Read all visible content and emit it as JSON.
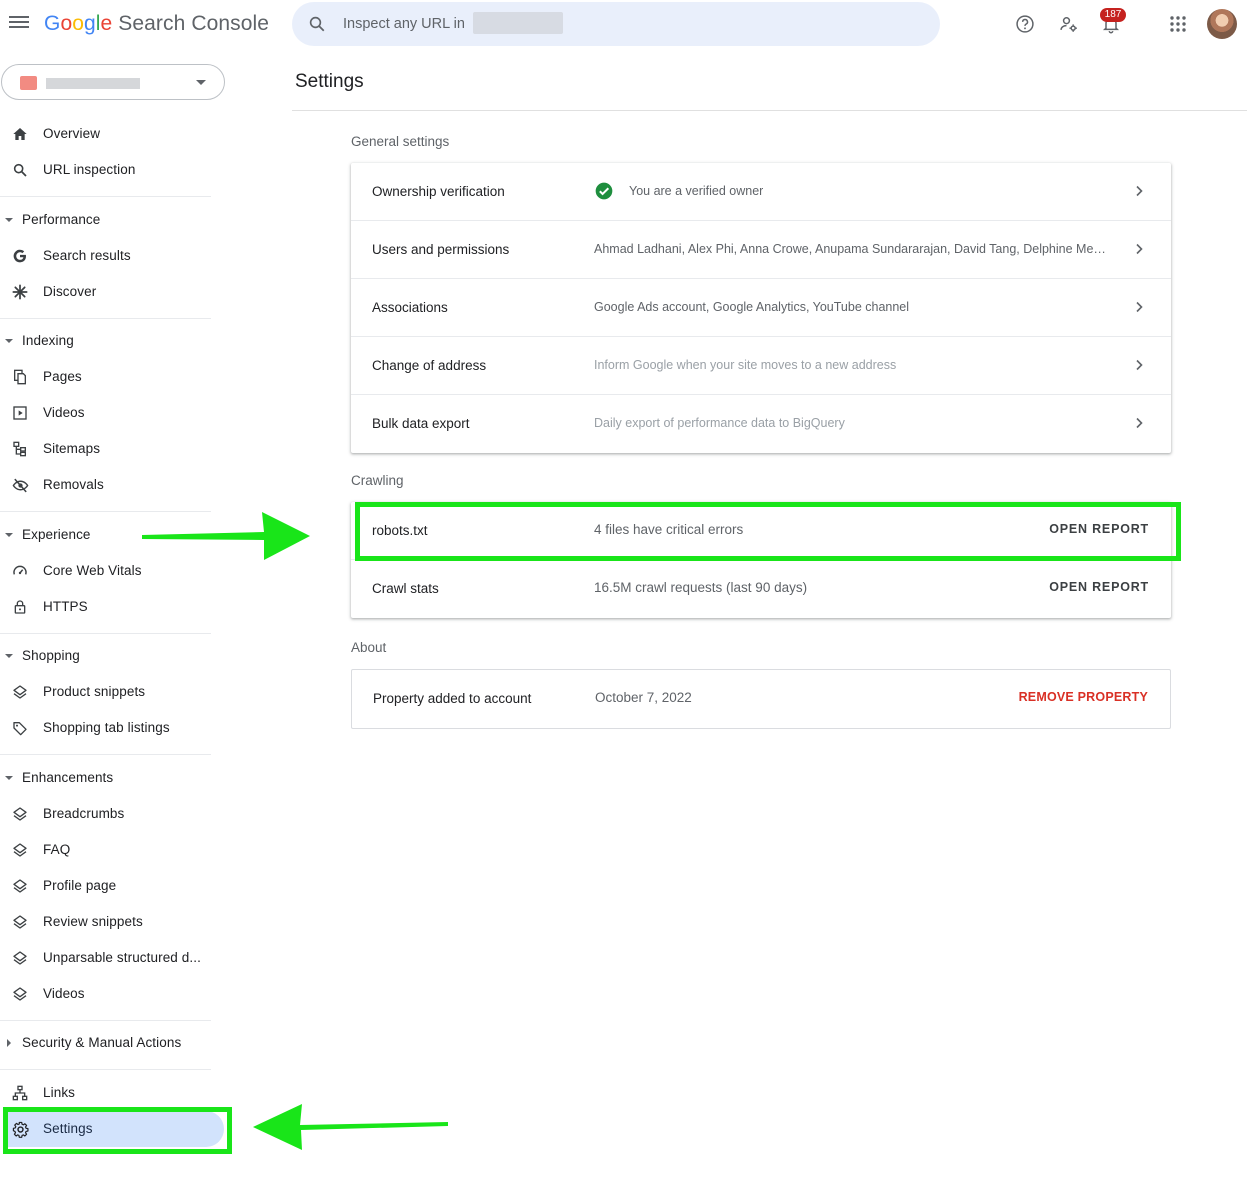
{
  "header": {
    "logo_brand": "Google",
    "logo_product": "Search Console",
    "search_placeholder": "Inspect any URL in",
    "notification_count": "187"
  },
  "sidebar": {
    "top_items": [
      {
        "label": "Overview",
        "icon": "home-icon"
      },
      {
        "label": "URL inspection",
        "icon": "search-icon"
      }
    ],
    "sections": [
      {
        "label": "Performance",
        "items": [
          {
            "label": "Search results",
            "icon": "google-g-icon"
          },
          {
            "label": "Discover",
            "icon": "asterisk-icon"
          }
        ]
      },
      {
        "label": "Indexing",
        "items": [
          {
            "label": "Pages",
            "icon": "pages-icon"
          },
          {
            "label": "Videos",
            "icon": "video-icon"
          },
          {
            "label": "Sitemaps",
            "icon": "sitemap-icon"
          },
          {
            "label": "Removals",
            "icon": "eye-off-icon"
          }
        ]
      },
      {
        "label": "Experience",
        "items": [
          {
            "label": "Core Web Vitals",
            "icon": "gauge-icon"
          },
          {
            "label": "HTTPS",
            "icon": "lock-icon"
          }
        ]
      },
      {
        "label": "Shopping",
        "items": [
          {
            "label": "Product snippets",
            "icon": "layers-icon"
          },
          {
            "label": "Shopping tab listings",
            "icon": "tag-icon"
          }
        ]
      },
      {
        "label": "Enhancements",
        "items": [
          {
            "label": "Breadcrumbs",
            "icon": "layers-icon"
          },
          {
            "label": "FAQ",
            "icon": "layers-icon"
          },
          {
            "label": "Profile page",
            "icon": "layers-icon"
          },
          {
            "label": "Review snippets",
            "icon": "layers-icon"
          },
          {
            "label": "Unparsable structured d...",
            "icon": "layers-icon"
          },
          {
            "label": "Videos",
            "icon": "layers-icon"
          }
        ]
      }
    ],
    "security_section": "Security & Manual Actions",
    "links_label": "Links",
    "settings_label": "Settings"
  },
  "main": {
    "title": "Settings",
    "general": {
      "label": "General settings",
      "rows": [
        {
          "title": "Ownership verification",
          "value": "You are a verified owner"
        },
        {
          "title": "Users and permissions",
          "value": "Ahmad Ladhani, Alex Phi, Anna Crowe, Anupama Sundararajan, David Tang, Delphine Merv..."
        },
        {
          "title": "Associations",
          "value": "Google Ads account, Google Analytics, YouTube channel"
        },
        {
          "title": "Change of address",
          "value": "Inform Google when your site moves to a new address"
        },
        {
          "title": "Bulk data export",
          "value": "Daily export of performance data to BigQuery"
        }
      ]
    },
    "crawling": {
      "label": "Crawling",
      "rows": [
        {
          "title": "robots.txt",
          "value": "4 files have critical errors",
          "action": "OPEN REPORT"
        },
        {
          "title": "Crawl stats",
          "value": "16.5M crawl requests (last 90 days)",
          "action": "OPEN REPORT"
        }
      ]
    },
    "about": {
      "label": "About",
      "row": {
        "title": "Property added to account",
        "value": "October 7, 2022",
        "action": "REMOVE PROPERTY"
      }
    }
  },
  "colors": {
    "highlight": "#19e519",
    "active_nav": "#d2e3fc",
    "danger": "#d93025",
    "verified": "#1e8e3e",
    "badge": "#c5221f"
  }
}
